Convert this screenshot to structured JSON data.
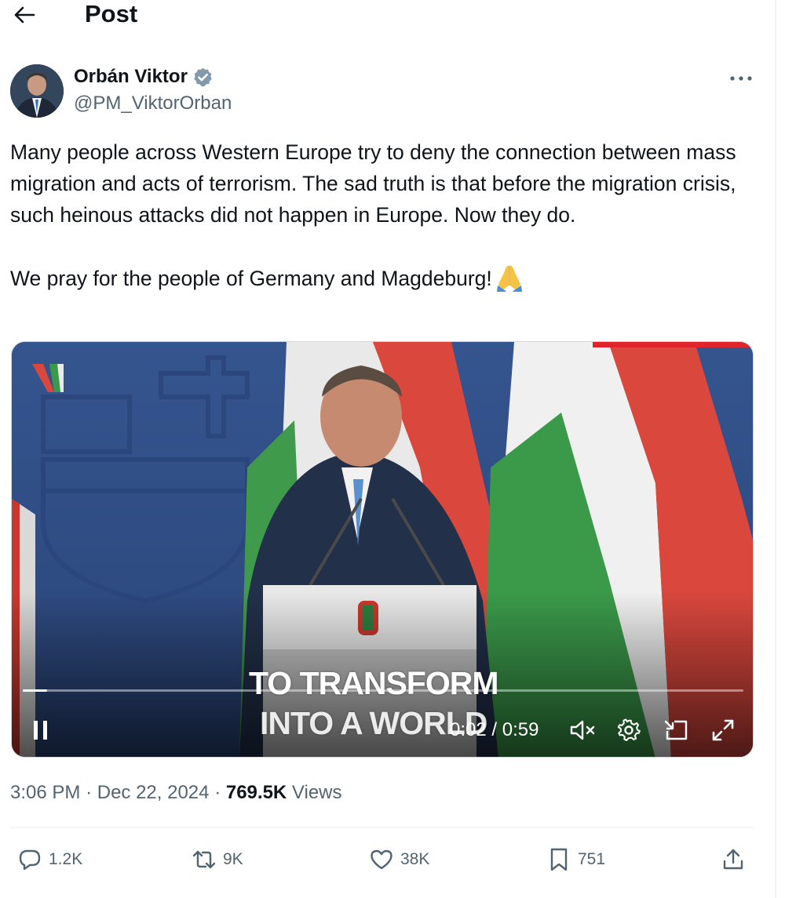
{
  "header": {
    "title": "Post",
    "back_icon": "arrow-left-icon"
  },
  "author": {
    "name": "Orbán Viktor",
    "handle": "@PM_ViktorOrban",
    "verified": true,
    "verified_color": "#829aab"
  },
  "tweet": {
    "paragraph1": "Many people across Western Europe try to deny the connection between mass migration and acts of terrorism. The sad truth is that before the migration crisis, such heinous attacks did not happen in Europe. Now they do.",
    "paragraph2": "We pray for the people of Germany and Magdeburg!",
    "emoji": "folded-hands-emoji"
  },
  "video": {
    "caption_line1": "TO TRANSFORM",
    "caption_line2": "INTO A WORLD",
    "time": "0:02 / 0:59",
    "progress": 0.034,
    "accent": "#e0242c"
  },
  "meta": {
    "time": "3:06 PM",
    "date": "Dec 22, 2024",
    "views_count": "769.5K",
    "views_label": "Views"
  },
  "actions": {
    "replies": "1.2K",
    "reposts": "9K",
    "likes": "38K",
    "bookmarks": "751"
  }
}
